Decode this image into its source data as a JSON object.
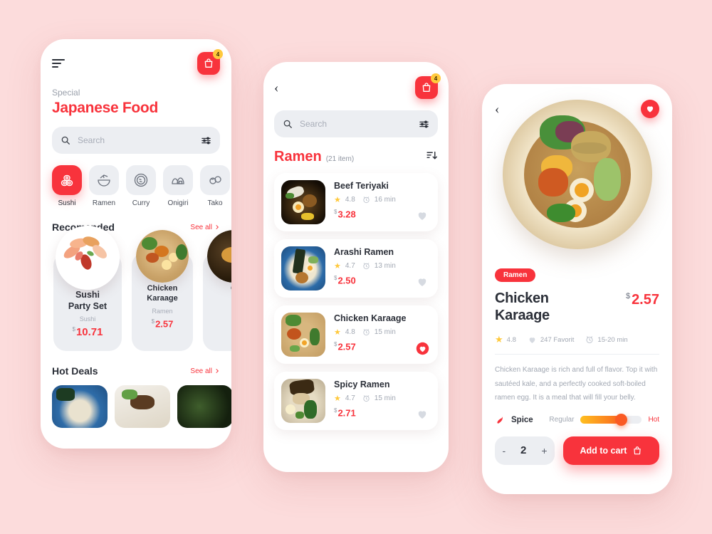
{
  "theme": {
    "accent": "#f8333c",
    "bg": "#fcdcdc",
    "star": "#ffc93c",
    "muted": "#a2a8b3"
  },
  "phone1": {
    "menu_icon": "hamburger-icon",
    "cart": {
      "icon": "cart-icon",
      "badge": "4"
    },
    "eyebrow": "Special",
    "title": "Japanese Food",
    "search": {
      "placeholder": "Search",
      "icon": "search-icon",
      "filter_icon": "filter-icon"
    },
    "categories": [
      {
        "label": "Sushi",
        "icon": "sushi-icon",
        "active": true
      },
      {
        "label": "Ramen",
        "icon": "ramen-icon",
        "active": false
      },
      {
        "label": "Curry",
        "icon": "curry-icon",
        "active": false
      },
      {
        "label": "Onigiri",
        "icon": "onigiri-icon",
        "active": false
      },
      {
        "label": "Tako",
        "icon": "takoyaki-icon",
        "active": false
      }
    ],
    "recommended": {
      "title": "Recomended",
      "see_all": "See all",
      "items": [
        {
          "name": "Sushi\nParty Set",
          "category": "Sushi",
          "currency": "$",
          "price": "10.71"
        },
        {
          "name": "Chicken\nKaraage",
          "category": "Ramen",
          "currency": "$",
          "price": "2.57"
        },
        {
          "name": "C",
          "category": "",
          "currency": "$",
          "price": ""
        }
      ]
    },
    "hot_deals": {
      "title": "Hot Deals",
      "see_all": "See all"
    }
  },
  "phone2": {
    "back_icon": "chevron-left-icon",
    "cart": {
      "icon": "cart-icon",
      "badge": "4"
    },
    "search": {
      "placeholder": "Search",
      "icon": "search-icon",
      "filter_icon": "filter-icon"
    },
    "list_title": "Ramen",
    "list_count": "(21 item)",
    "sort_icon": "sort-descending-icon",
    "items": [
      {
        "name": "Beef Teriyaki",
        "rating": "4.8",
        "time": "16 min",
        "currency": "$",
        "price": "3.28",
        "favorite": false
      },
      {
        "name": "Arashi Ramen",
        "rating": "4.7",
        "time": "13 min",
        "currency": "$",
        "price": "2.50",
        "favorite": false
      },
      {
        "name": "Chicken Karaage",
        "rating": "4.8",
        "time": "15 min",
        "currency": "$",
        "price": "2.57",
        "favorite": true
      },
      {
        "name": "Spicy Ramen",
        "rating": "4.7",
        "time": "15 min",
        "currency": "$",
        "price": "2.71",
        "favorite": false
      }
    ]
  },
  "phone3": {
    "back_icon": "chevron-left-icon",
    "favorite_icon": "heart-icon",
    "tag": "Ramen",
    "title": "Chicken Karaage",
    "currency": "$",
    "price": "2.57",
    "stats": {
      "rating": "4.8",
      "favorites": "247 Favorit",
      "time": "15-20 min"
    },
    "description": "Chicken Karaage is rich and full of flavor. Top it with sautéed kale, and a perfectly cooked soft-boiled ramen egg. It is a meal that will fill your belly.",
    "spice": {
      "label": "Spice",
      "min_label": "Regular",
      "max_label": "Hot",
      "value": 64
    },
    "quantity": {
      "minus": "-",
      "value": "2",
      "plus": "+"
    },
    "add_to_cart": "Add to cart"
  }
}
